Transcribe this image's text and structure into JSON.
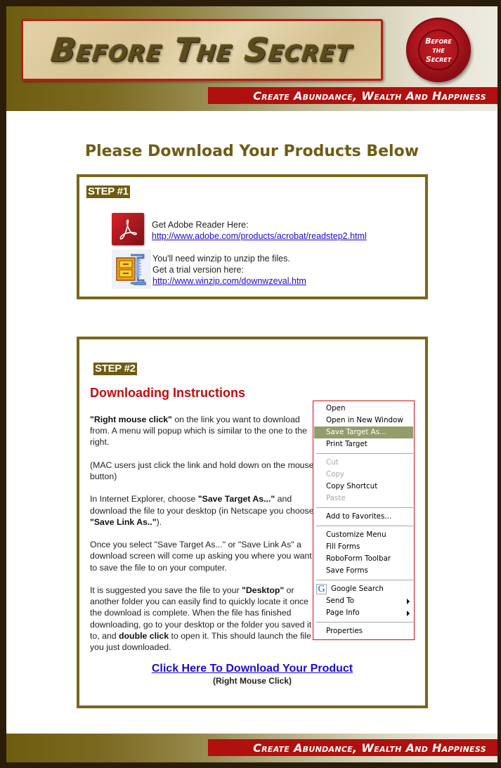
{
  "header": {
    "site_title": "Before The Secret",
    "seal_text": "Before\nthe\nSecret",
    "tagline": "Create Abundance, Wealth And Happiness"
  },
  "main": {
    "heading": "Please Download Your Products Below",
    "step1": {
      "label": "STEP #1",
      "rows": [
        {
          "icon": "adobe-reader-icon",
          "lines": [
            "Get Adobe Reader Here:"
          ],
          "link": "http://www.adobe.com/products/acrobat/readstep2.html"
        },
        {
          "icon": "winzip-icon",
          "lines": [
            "You'll need winzip to unzip the files.",
            "Get a trial version here:"
          ],
          "link": "http://www.winzip.com/downwzeval.htm"
        }
      ]
    },
    "step2": {
      "label": "STEP #2",
      "heading": "Downloading Instructions",
      "paragraphs": {
        "p1_bold": "\"Right mouse click\"",
        "p1_rest": " on the  link you want to download from. A menu will popup which is similar to the one to the right.",
        "p2": "(MAC users just click the link and hold down on the mouse button)",
        "p3_a": "In Internet Explorer, choose ",
        "p3_bold1": "\"Save Target As...\"",
        "p3_b": " and download the file to your desktop (in Netscape you choose ",
        "p3_bold2": "\"Save Link As..\"",
        "p3_c": ").",
        "p4": "Once you select \"Save Target As...\" or \"Save Link As\" a download screen will come up asking you where you want to save the file to on your computer.",
        "p5_a": "It is suggested you save  the file to your ",
        "p5_bold1": "\"Desktop\"",
        "p5_b": " or another folder you can easily find to quickly locate it once the download is complete. When the file has finished downloading, go to your desktop or the folder you saved it to, and ",
        "p5_bold2": "double click",
        "p5_c": " to open it. This should launch the file you just downloaded."
      },
      "context_menu": {
        "items": [
          {
            "label": "Open"
          },
          {
            "label": "Open in New Window"
          },
          {
            "label": "Save Target As...",
            "state": "selected"
          },
          {
            "label": "Print Target"
          },
          {
            "label": "Cut",
            "state": "disabled"
          },
          {
            "label": "Copy",
            "state": "disabled"
          },
          {
            "label": "Copy Shortcut"
          },
          {
            "label": "Paste",
            "state": "disabled"
          },
          {
            "label": "Add to Favorites..."
          },
          {
            "label": "Customize Menu"
          },
          {
            "label": "Fill Forms"
          },
          {
            "label": "RoboForm Toolbar"
          },
          {
            "label": "Save Forms"
          },
          {
            "label": "Google Search",
            "icon": "google-icon",
            "icon_glyph": "G"
          },
          {
            "label": "Send To",
            "submenu": true
          },
          {
            "label": "Page Info",
            "submenu": true
          },
          {
            "label": "Properties"
          }
        ]
      },
      "download_link": "Click Here To Download Your Product",
      "download_note": "(Right Mouse Click)"
    }
  },
  "footer": {
    "tagline": "Create Abundance, Wealth And Happiness"
  },
  "colors": {
    "frame": "#2a1e0a",
    "olive": "#7a661c",
    "heading_olive": "#6e5c14",
    "accent_red": "#b0100e",
    "instructions_red": "#c00d0d",
    "link_blue": "#1a0dcc",
    "menu_selected": "#949c6c"
  }
}
